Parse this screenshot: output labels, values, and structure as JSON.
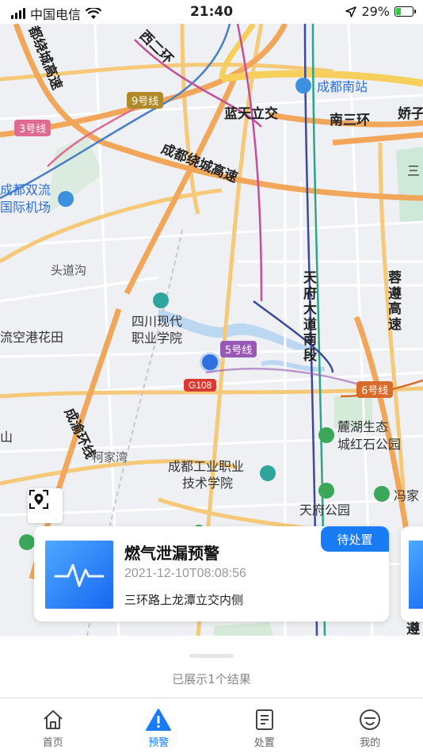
{
  "status": {
    "carrier": "中国电信",
    "time": "21:40",
    "battery": "29%",
    "battery_level": 0.29
  },
  "map": {
    "labels": {
      "ring_west": "西二环",
      "line9": "9号线",
      "line3": "3号线",
      "raocheng_left": "都绕城高速",
      "nanzhan": "成都南站",
      "lantian": "蓝天立交",
      "nansanhuan": "南三环",
      "jiaozi": "娇子",
      "raocheng_mid": "成都绕城高速",
      "san": "三",
      "shuangliu_1": "成都双流",
      "shuangliu_2": "国际机场",
      "toudaogou": "头道沟",
      "tianfu": "天府大道南段",
      "rongzun": "蓉遵高速",
      "sichuan_1": "四川现代",
      "sichuan_2": "职业学院",
      "liukong": "流空港花田",
      "line5": "5号线",
      "g108": "G108",
      "line6": "6号线",
      "chengyu": "成渝环线",
      "shan": "山",
      "lulake_1": "麓湖生态",
      "lulake_2": "城红石公园",
      "kejiawan": "柯家湾",
      "gongye_1": "成都工业职业",
      "gongye_2": "技术学院",
      "tianfupark": "天府公园",
      "fengjia": "冯家",
      "zun": "遵"
    },
    "colors": {
      "line9": "#b08a2a",
      "line3": "#e06b91",
      "line5": "#9b59b6",
      "line6": "#d96a2a",
      "g108": "#d93a30"
    }
  },
  "card": {
    "title": "燃气泄漏预警",
    "time": "2021-12-10T08:08:56",
    "address": "三环路上龙潭立交内侧",
    "status_tag": "待处置"
  },
  "results": {
    "text": "已展示1个结果"
  },
  "tabs": [
    {
      "label": "首页",
      "icon": "home-icon"
    },
    {
      "label": "预警",
      "icon": "warning-icon"
    },
    {
      "label": "处置",
      "icon": "document-icon"
    },
    {
      "label": "我的",
      "icon": "profile-icon"
    }
  ],
  "accent": "#1a7cf5"
}
